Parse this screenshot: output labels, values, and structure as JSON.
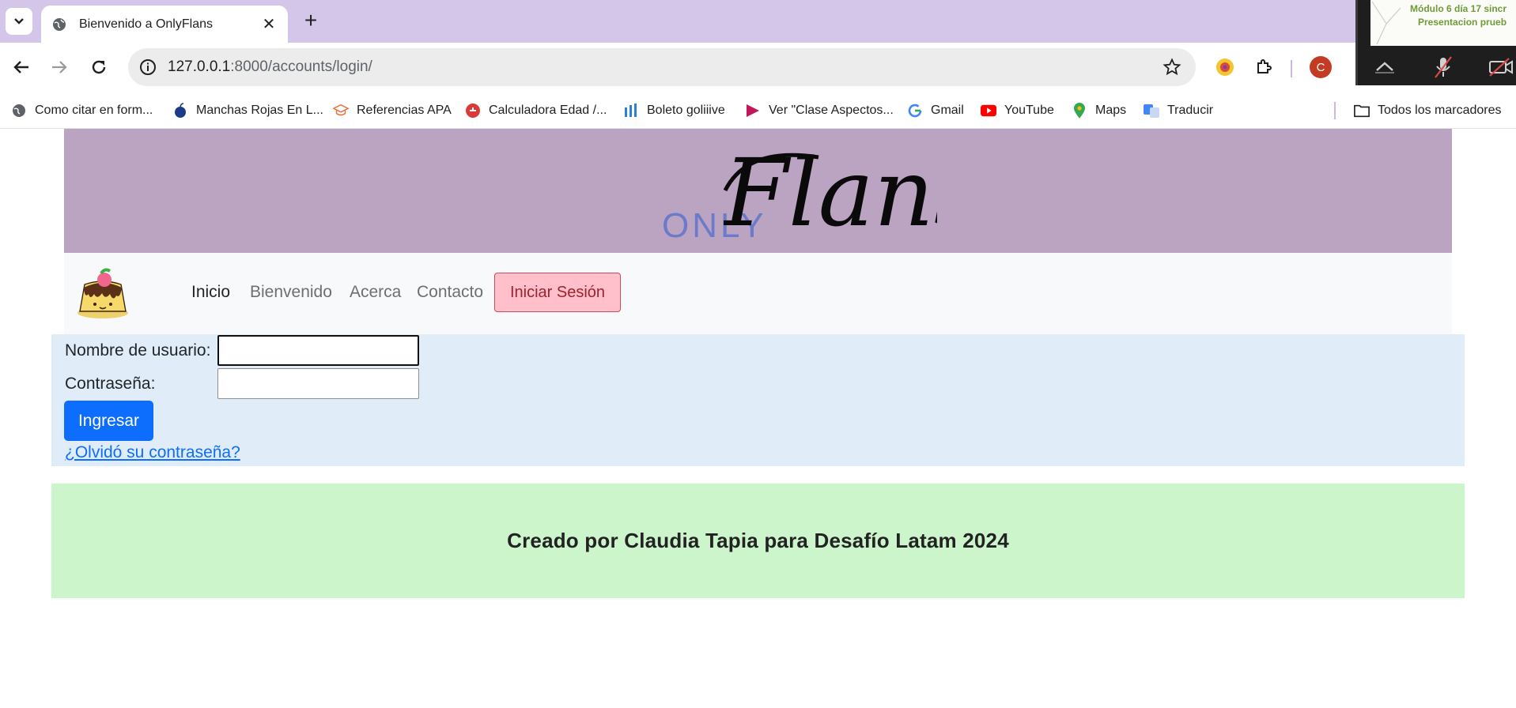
{
  "browser": {
    "tab_title": "Bienvenido a OnlyFlans",
    "url_host": "127.0.0.1",
    "url_path": ":8000/accounts/login/",
    "profile_initial": "C",
    "bookmarks": [
      {
        "label": "Como citar en form...",
        "icon": "globe-icon"
      },
      {
        "label": "Manchas Rojas En L...",
        "icon": "apple-icon"
      },
      {
        "label": "Referencias APA",
        "icon": "graduation-cap-icon"
      },
      {
        "label": "Calculadora Edad /...",
        "icon": "calculator-icon"
      },
      {
        "label": "Boleto goliiive",
        "icon": "ticket-icon"
      },
      {
        "label": "Ver \"Clase Aspectos...",
        "icon": "play-icon"
      },
      {
        "label": "Gmail",
        "icon": "google-icon"
      },
      {
        "label": "YouTube",
        "icon": "youtube-icon"
      },
      {
        "label": "Maps",
        "icon": "maps-pin-icon"
      },
      {
        "label": "Traducir",
        "icon": "translate-icon"
      }
    ],
    "all_bookmarks_label": "Todos los marcadores"
  },
  "video_overlay": {
    "line1": "Módulo 6 día 17 sincr",
    "line2": "Presentacion prueb"
  },
  "header": {
    "logo_small": "ONLY",
    "logo_script": "Flans"
  },
  "nav": {
    "items": [
      {
        "label": "Inicio",
        "active": true
      },
      {
        "label": "Bienvenido",
        "active": false
      },
      {
        "label": "Acerca",
        "active": false
      },
      {
        "label": "Contacto",
        "active": false
      }
    ],
    "login_label": "Iniciar Sesión"
  },
  "login": {
    "username_label": "Nombre de usuario:",
    "username_value": "",
    "password_label": "Contraseña:",
    "password_value": "",
    "submit_label": "Ingresar",
    "forgot_label": "¿Olvidó su contraseña?"
  },
  "footer": {
    "text": "Creado por Claudia Tapia para Desafío Latam 2024"
  },
  "colors": {
    "hero_bg": "#bba3c2",
    "login_bg": "#e0ecf7",
    "footer_bg": "#ccf5cc",
    "primary": "#0d6efd",
    "login_btn_bg": "#ffc0cb"
  }
}
